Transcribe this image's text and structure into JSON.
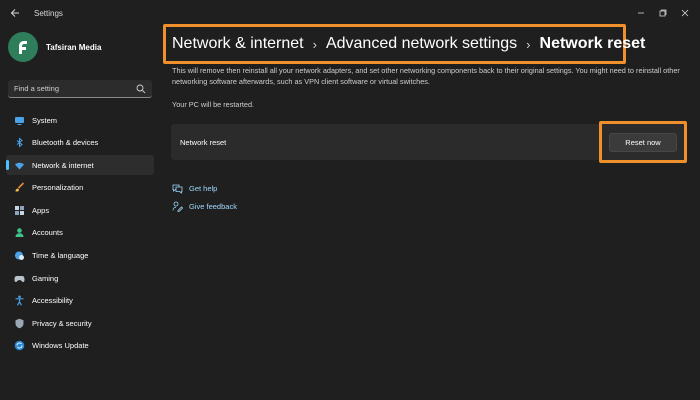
{
  "window": {
    "title": "Settings",
    "controls": [
      "minimize",
      "maximize",
      "close"
    ]
  },
  "profile": {
    "name": "Tafsiran Media",
    "avatar_color": "#2e7d5b"
  },
  "search": {
    "placeholder": "Find a setting"
  },
  "sidebar": {
    "items": [
      {
        "label": "System",
        "icon": "system-icon"
      },
      {
        "label": "Bluetooth & devices",
        "icon": "bluetooth-icon"
      },
      {
        "label": "Network & internet",
        "icon": "wifi-icon",
        "active": true
      },
      {
        "label": "Personalization",
        "icon": "brush-icon"
      },
      {
        "label": "Apps",
        "icon": "apps-icon"
      },
      {
        "label": "Accounts",
        "icon": "person-icon"
      },
      {
        "label": "Time & language",
        "icon": "globe-clock-icon"
      },
      {
        "label": "Gaming",
        "icon": "gamepad-icon"
      },
      {
        "label": "Accessibility",
        "icon": "accessibility-icon"
      },
      {
        "label": "Privacy & security",
        "icon": "shield-icon"
      },
      {
        "label": "Windows Update",
        "icon": "update-icon"
      }
    ]
  },
  "breadcrumb": {
    "items": [
      "Network & internet",
      "Advanced network settings",
      "Network reset"
    ],
    "separator": "›"
  },
  "main": {
    "description": "This will remove then reinstall all your network adapters, and set other networking components back to their original settings. You might need to reinstall other networking software afterwards, such as VPN client software or virtual switches.",
    "restart_note": "Your PC will be restarted.",
    "card_label": "Network reset",
    "reset_button": "Reset now",
    "links": [
      {
        "label": "Get help",
        "icon": "help-icon"
      },
      {
        "label": "Give feedback",
        "icon": "feedback-icon"
      }
    ]
  },
  "colors": {
    "accent": "#4cc2ff",
    "highlight": "#f0902a",
    "link": "#9fd8ff"
  }
}
